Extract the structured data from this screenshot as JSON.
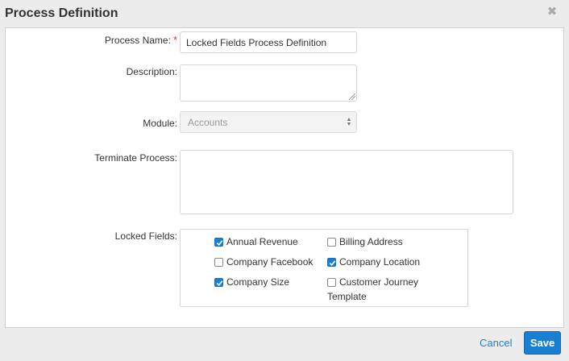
{
  "modal": {
    "title": "Process Definition",
    "close_icon": "close-icon"
  },
  "form": {
    "process_name": {
      "label": "Process Name:",
      "required_mark": "*",
      "value": "Locked Fields Process Definition"
    },
    "description": {
      "label": "Description:",
      "value": ""
    },
    "module": {
      "label": "Module:",
      "selected": "Accounts"
    },
    "terminate_process": {
      "label": "Terminate Process:"
    },
    "locked_fields": {
      "label": "Locked Fields:",
      "options": [
        {
          "label": "Annual Revenue",
          "checked": true
        },
        {
          "label": "Billing Address",
          "checked": false
        },
        {
          "label": "Company Facebook",
          "checked": false
        },
        {
          "label": "Company Location",
          "checked": true
        },
        {
          "label": "Company Size",
          "checked": true
        },
        {
          "label": "Customer Journey Template",
          "checked": false
        }
      ]
    }
  },
  "footer": {
    "cancel_label": "Cancel",
    "save_label": "Save"
  },
  "colors": {
    "accent": "#1a7fd1",
    "required": "#d9302c"
  }
}
